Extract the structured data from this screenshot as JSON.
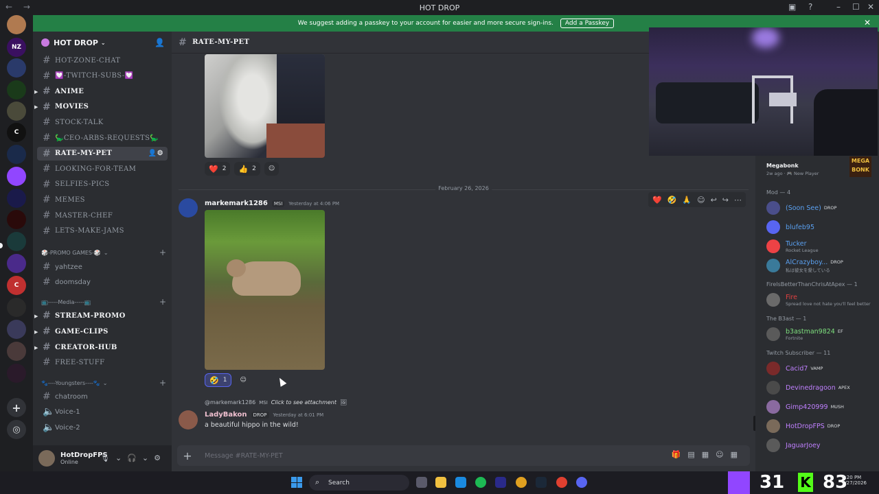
{
  "window": {
    "title": "HOT DROP"
  },
  "notice": {
    "text": "We suggest adding a passkey to your account for easier and more secure sign-ins.",
    "button": "Add a Passkey"
  },
  "guild": {
    "name": "HOT DROP"
  },
  "channels": [
    {
      "name": "HOT-ZONE-CHAT",
      "style": "caps"
    },
    {
      "name": "💟-TWITCH-SUBS-💟",
      "style": "caps"
    },
    {
      "name": "ANIME",
      "style": "bold-caps",
      "arrow": true
    },
    {
      "name": "MOVIES",
      "style": "bold-caps",
      "arrow": true
    },
    {
      "name": "STOCK-TALK",
      "style": "caps"
    },
    {
      "name": "🦕CEO-ARBS-REQUESTS🦕",
      "style": "caps"
    },
    {
      "name": "RATE-MY-PET",
      "style": "active"
    },
    {
      "name": "LOOKING-FOR-TEAM",
      "style": "caps"
    },
    {
      "name": "SELFIES-PICS",
      "style": "caps"
    },
    {
      "name": "MEMES",
      "style": "caps"
    },
    {
      "name": "MASTER-CHEF",
      "style": "caps"
    },
    {
      "name": "LETS-MAKE-JAMS",
      "style": "caps"
    }
  ],
  "category_promo": {
    "name": "🎲-PROMO GAMES-🎲"
  },
  "promo_channels": [
    "yahtzee",
    "doomsday"
  ],
  "category_media": {
    "name": "📺-----Media-----📺"
  },
  "media_channels": [
    "STREAM-PROMO",
    "GAME-CLIPS",
    "CREATOR-HUB",
    "FREE-STUFF"
  ],
  "category_youngsters": {
    "name": "🐾----Youngsters----🐾"
  },
  "youngsters_channels": [
    "chatroom",
    "Voice-1",
    "Voice-2"
  ],
  "user": {
    "name": "HotDropFPS",
    "status": "Online"
  },
  "chat": {
    "channel": "RATE-MY-PET",
    "reactions1": [
      {
        "emoji": "❤️",
        "count": "2"
      },
      {
        "emoji": "👍",
        "count": "2"
      }
    ],
    "date_divider": "February 26, 2026",
    "msg1": {
      "author": "markemark1286",
      "tag": "MSI",
      "time": "Yesterday at 4:06 PM"
    },
    "reactions2": [
      {
        "emoji": "🤣",
        "count": "1"
      }
    ],
    "reply": {
      "author": "@markemark1286",
      "tag": "MSI",
      "text": "Click to see attachment"
    },
    "msg2": {
      "author": "LadyBakon",
      "tag": "DROP",
      "time": "Yesterday at 6:01 PM",
      "text": "a beautiful hippo in the wild!"
    },
    "composer_placeholder": "Message #RATE-MY-PET"
  },
  "game_card": {
    "name": "Megabonk",
    "sub": "2w ago · 🎮 New Player",
    "icon_text": "MEGA BONK"
  },
  "member_groups": [
    {
      "title": "Mod — 4",
      "members": [
        {
          "name": "(Soon See)",
          "tag": "DROP",
          "color": "#5aa0f0",
          "avatar": "#4a4e8a"
        },
        {
          "name": "blufeb95",
          "color": "#5aa0f0",
          "avatar": "#5865f2"
        },
        {
          "name": "Tucker",
          "activity": "Rocket League",
          "color": "#5aa0f0",
          "avatar": "#ed4245"
        },
        {
          "name": "AlCrazyboy...",
          "tag": "DROP",
          "activity": "私は彼女を愛している",
          "color": "#5aa0f0",
          "avatar": "#3a7a9a"
        }
      ]
    },
    {
      "title": "FireIsBetterThanChrisAtApex — 1",
      "members": [
        {
          "name": "Fire",
          "activity": "Spread love not hate you'll feel better",
          "color": "#e04040",
          "avatar": "#6a6a6a"
        }
      ]
    },
    {
      "title": "The B3ast — 1",
      "members": [
        {
          "name": "b3astman9824",
          "tag": "EF",
          "activity": "Fortnite",
          "color": "#7ee07e",
          "avatar": "#5a5a5a"
        }
      ]
    },
    {
      "title": "Twitch Subscriber — 11",
      "members": [
        {
          "name": "Cacid7",
          "tag": "VAMP",
          "color": "#c080ff",
          "avatar": "#7a2a2a"
        },
        {
          "name": "Devinedragoon",
          "tag": "APEX",
          "color": "#c080ff",
          "avatar": "#4a4a4a"
        },
        {
          "name": "Gimp420999",
          "tag": "MUSH",
          "color": "#c080ff",
          "avatar": "#8a6aa0"
        },
        {
          "name": "HotDropFPS",
          "tag": "DROP",
          "color": "#c080ff",
          "avatar": "#7a6a5a"
        },
        {
          "name": "JaguarJoey",
          "color": "#c080ff",
          "avatar": "#5a5a5a"
        }
      ]
    }
  ],
  "taskbar": {
    "search": "Search",
    "overlay_left": "31",
    "overlay_right": "83",
    "time": "5:20 PM",
    "date": "2/27/2026"
  },
  "icons": {
    "search": "search-icon",
    "settings": "gear-icon",
    "mic": "mic-icon",
    "headset": "headset-icon"
  }
}
